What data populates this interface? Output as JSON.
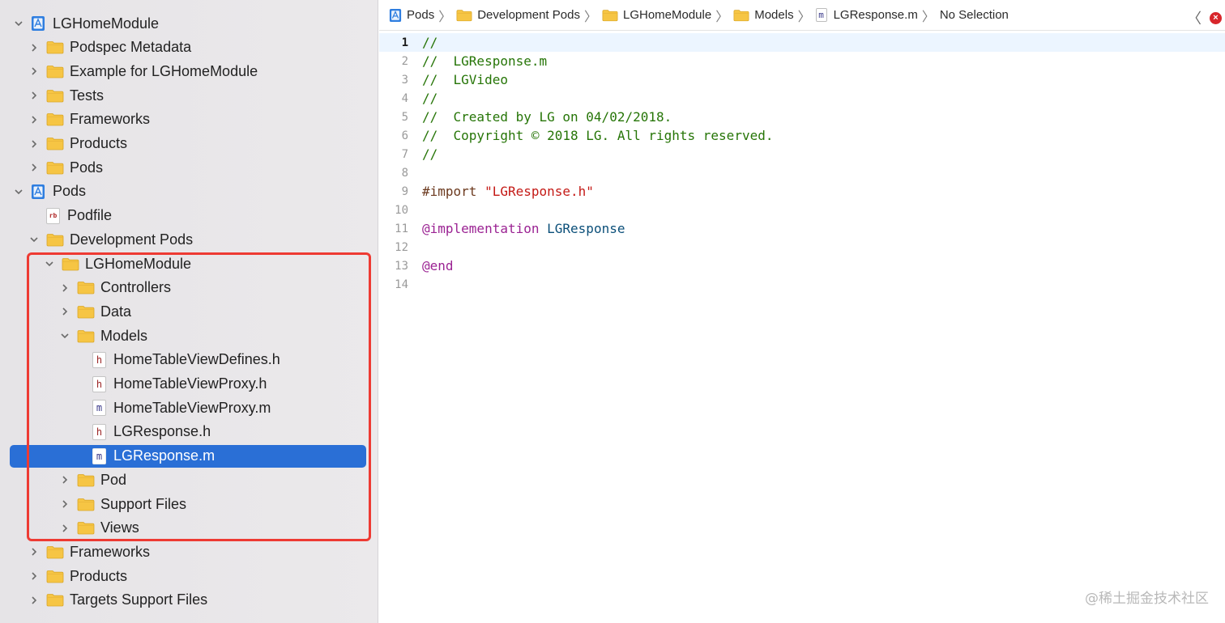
{
  "navigator": {
    "rows": [
      {
        "label": "LGHomeModule",
        "icon": "xcodeproj-icon",
        "expanded": true,
        "depth": 0
      },
      {
        "label": "Podspec Metadata",
        "icon": "folder-icon",
        "expanded": false,
        "depth": 1
      },
      {
        "label": "Example for LGHomeModule",
        "icon": "folder-icon",
        "expanded": false,
        "depth": 1
      },
      {
        "label": "Tests",
        "icon": "folder-icon",
        "expanded": false,
        "depth": 1
      },
      {
        "label": "Frameworks",
        "icon": "folder-icon",
        "expanded": false,
        "depth": 1
      },
      {
        "label": "Products",
        "icon": "folder-icon",
        "expanded": false,
        "depth": 1
      },
      {
        "label": "Pods",
        "icon": "folder-icon",
        "expanded": false,
        "depth": 1
      },
      {
        "label": "Pods",
        "icon": "xcodeproj-icon",
        "expanded": true,
        "depth": 0
      },
      {
        "label": "Podfile",
        "icon": "ruby-file-icon",
        "badge": "rb",
        "depth": 1
      },
      {
        "label": "Development Pods",
        "icon": "folder-icon",
        "expanded": true,
        "depth": 1
      },
      {
        "label": "LGHomeModule",
        "icon": "folder-icon",
        "expanded": true,
        "depth": 2
      },
      {
        "label": "Controllers",
        "icon": "folder-icon",
        "expanded": false,
        "depth": 3
      },
      {
        "label": "Data",
        "icon": "folder-icon",
        "expanded": false,
        "depth": 3
      },
      {
        "label": "Models",
        "icon": "folder-icon",
        "expanded": true,
        "depth": 3
      },
      {
        "label": "HomeTableViewDefines.h",
        "icon": "header-file-icon",
        "badge": "h",
        "depth": 4
      },
      {
        "label": "HomeTableViewProxy.h",
        "icon": "header-file-icon",
        "badge": "h",
        "depth": 4
      },
      {
        "label": "HomeTableViewProxy.m",
        "icon": "objc-file-icon",
        "badge": "m",
        "depth": 4
      },
      {
        "label": "LGResponse.h",
        "icon": "header-file-icon",
        "badge": "h",
        "depth": 4
      },
      {
        "label": "LGResponse.m",
        "icon": "objc-file-icon",
        "badge": "m",
        "depth": 4,
        "selected": true
      },
      {
        "label": "Pod",
        "icon": "folder-icon",
        "expanded": false,
        "depth": 3
      },
      {
        "label": "Support Files",
        "icon": "folder-icon",
        "expanded": false,
        "depth": 3
      },
      {
        "label": "Views",
        "icon": "folder-icon",
        "expanded": false,
        "depth": 3
      },
      {
        "label": "Frameworks",
        "icon": "folder-icon",
        "expanded": false,
        "depth": 1
      },
      {
        "label": "Products",
        "icon": "folder-icon",
        "expanded": false,
        "depth": 1
      },
      {
        "label": "Targets Support Files",
        "icon": "folder-icon",
        "expanded": false,
        "depth": 1
      }
    ]
  },
  "jumpbar": {
    "crumbs": [
      {
        "label": "Pods",
        "icon": "xcodeproj-icon"
      },
      {
        "label": "Development Pods",
        "icon": "folder-icon"
      },
      {
        "label": "LGHomeModule",
        "icon": "folder-icon"
      },
      {
        "label": "Models",
        "icon": "folder-icon"
      },
      {
        "label": "LGResponse.m",
        "icon": "objc-file-icon",
        "badge": "m"
      },
      {
        "label": "No Selection",
        "icon": ""
      }
    ],
    "back_glyph": "〈",
    "error_glyph": "×"
  },
  "editor": {
    "current_line": 1,
    "lines": [
      {
        "num": "1",
        "tokens": [
          {
            "t": "//",
            "c": "comment"
          }
        ]
      },
      {
        "num": "2",
        "tokens": [
          {
            "t": "//  LGResponse.m",
            "c": "comment"
          }
        ]
      },
      {
        "num": "3",
        "tokens": [
          {
            "t": "//  LGVideo",
            "c": "comment"
          }
        ]
      },
      {
        "num": "4",
        "tokens": [
          {
            "t": "//",
            "c": "comment"
          }
        ]
      },
      {
        "num": "5",
        "tokens": [
          {
            "t": "//  Created by LG on 04/02/2018.",
            "c": "comment"
          }
        ]
      },
      {
        "num": "6",
        "tokens": [
          {
            "t": "//  Copyright © 2018 LG. All rights reserved.",
            "c": "comment"
          }
        ]
      },
      {
        "num": "7",
        "tokens": [
          {
            "t": "//",
            "c": "comment"
          }
        ]
      },
      {
        "num": "8",
        "tokens": []
      },
      {
        "num": "9",
        "tokens": [
          {
            "t": "#import ",
            "c": "pre"
          },
          {
            "t": "\"LGResponse.h\"",
            "c": "string"
          }
        ]
      },
      {
        "num": "10",
        "tokens": []
      },
      {
        "num": "11",
        "tokens": [
          {
            "t": "@implementation",
            "c": "kw"
          },
          {
            "t": " ",
            "c": "plain"
          },
          {
            "t": "LGResponse",
            "c": "type"
          }
        ]
      },
      {
        "num": "12",
        "tokens": []
      },
      {
        "num": "13",
        "tokens": [
          {
            "t": "@end",
            "c": "kw"
          }
        ]
      },
      {
        "num": "14",
        "tokens": []
      }
    ]
  },
  "watermark": "@稀土掘金技术社区",
  "colors": {
    "selection": "#2a6fd6",
    "annotation": "#ee3a33",
    "folder": "#f6c544",
    "comment": "#267507",
    "keyword": "#9b2393"
  }
}
